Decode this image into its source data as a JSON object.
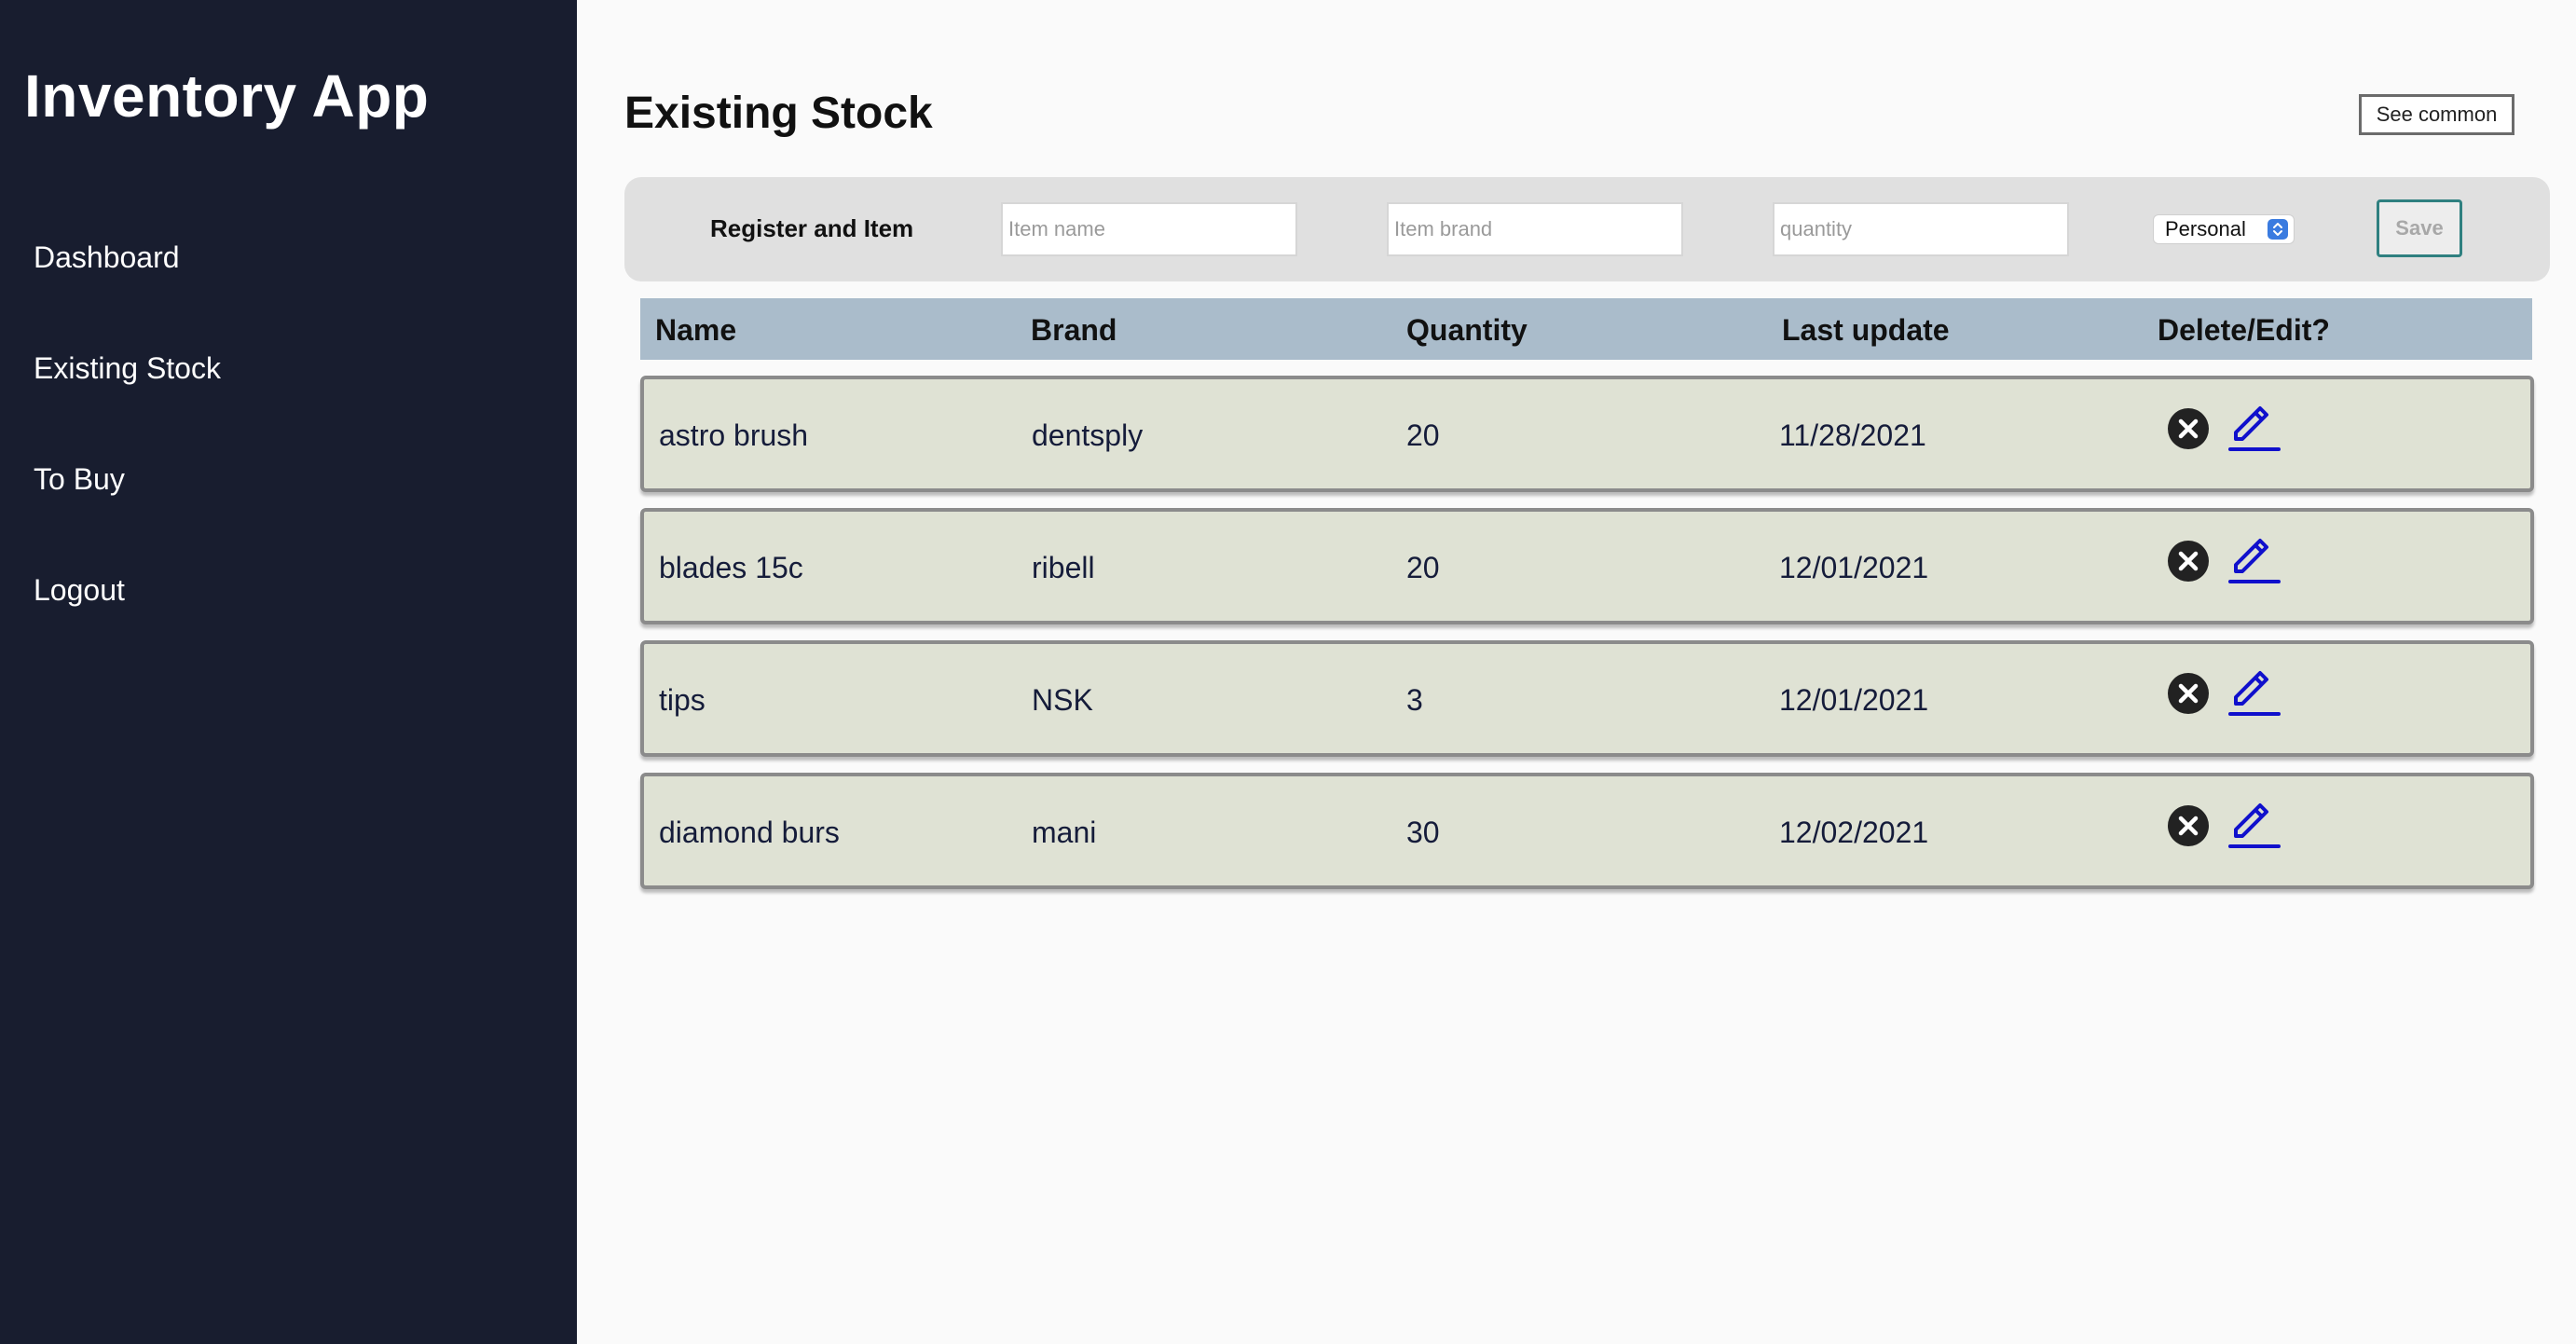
{
  "sidebar": {
    "app_title": "Inventory App",
    "items": [
      {
        "label": "Dashboard"
      },
      {
        "label": "Existing Stock"
      },
      {
        "label": "To Buy"
      },
      {
        "label": "Logout"
      }
    ]
  },
  "main": {
    "page_title": "Existing Stock",
    "see_common_label": "See common"
  },
  "register": {
    "label": "Register and Item",
    "item_name_placeholder": "Item name",
    "item_brand_placeholder": "Item brand",
    "quantity_placeholder": "quantity",
    "category_selected": "Personal",
    "save_label": "Save"
  },
  "table": {
    "headers": [
      "Name",
      "Brand",
      "Quantity",
      "Last update",
      "Delete/Edit?"
    ],
    "rows": [
      {
        "name": "astro brush",
        "brand": "dentsply",
        "quantity": "20",
        "last_update": "11/28/2021"
      },
      {
        "name": "blades 15c",
        "brand": "ribell",
        "quantity": "20",
        "last_update": "12/01/2021"
      },
      {
        "name": "tips",
        "brand": "NSK",
        "quantity": "3",
        "last_update": "12/01/2021"
      },
      {
        "name": "diamond burs",
        "brand": "mani",
        "quantity": "30",
        "last_update": "12/02/2021"
      }
    ]
  },
  "colors": {
    "sidebar_bg": "#181d2f",
    "header_bg": "#aabccb",
    "row_bg": "#dfe2d4",
    "delete_icon": "#222222",
    "edit_icon": "#1010cc",
    "save_border": "#2f8080"
  },
  "icons": {
    "delete": "x-circle-icon",
    "edit": "pencil-icon",
    "select": "select-arrows-icon"
  }
}
